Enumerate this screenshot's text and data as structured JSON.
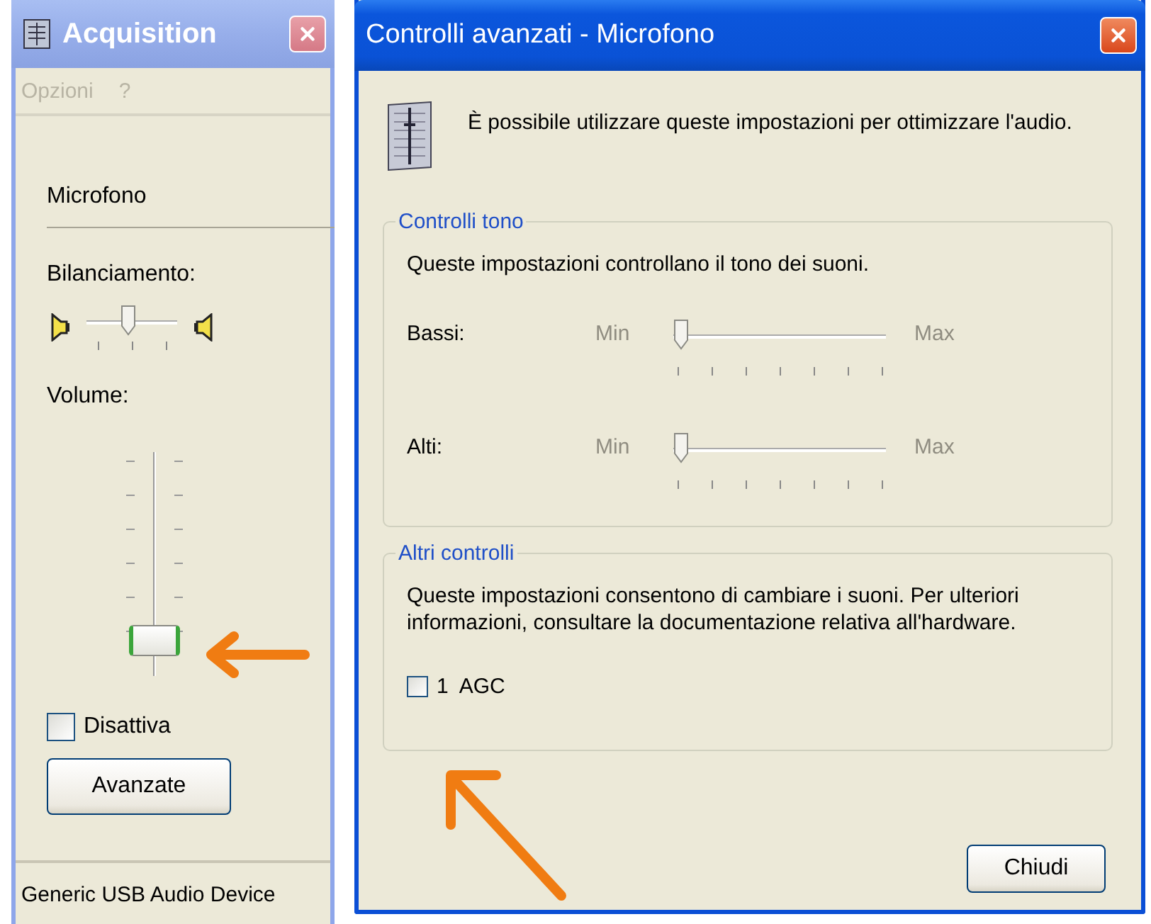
{
  "mixer_window": {
    "title": "Acquisition",
    "active": false,
    "menu": [
      "Opzioni",
      "?"
    ],
    "channel": "Microfono",
    "balance": {
      "label": "Bilanciamento:",
      "level": 0.45
    },
    "volume": {
      "label": "Volume:",
      "level": 0.1
    },
    "mute": {
      "label": "Disattiva",
      "checked": false
    },
    "advanced_button": "Avanzate",
    "status_bar": "Generic USB Audio Device"
  },
  "advanced_window": {
    "title": "Controlli avanzati - Microfono",
    "active": true,
    "intro": "È possibile utilizzare queste impostazioni per ottimizzare l'audio.",
    "groups": [
      {
        "kind": "sliders",
        "title": "Controlli tono",
        "text": "Queste impostazioni controllano il tono dei suoni.",
        "sliders": [
          {
            "label": "Bassi:",
            "min": "Min",
            "max": "Max",
            "disabled": true,
            "level": 0
          },
          {
            "label": "Alti:",
            "min": "Min",
            "max": "Max",
            "disabled": true,
            "level": 0
          }
        ]
      },
      {
        "kind": "checkboxes",
        "title": "Altri controlli",
        "text": "Queste impostazioni consentono di cambiare i suoni. Per ulteriori informazioni, consultare la documentazione relativa all'hardware.",
        "checkboxes": [
          {
            "label": "1  AGC",
            "checked": false
          }
        ]
      }
    ],
    "close_button": "Chiudi"
  }
}
